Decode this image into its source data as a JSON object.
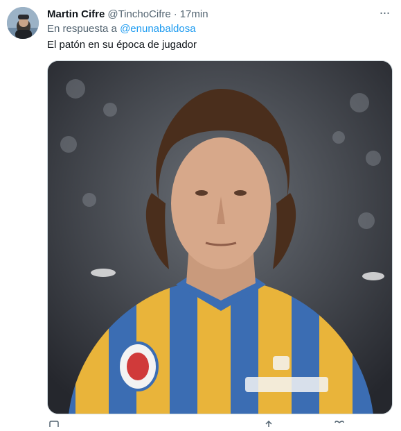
{
  "tweet": {
    "author_name": "Martin Cifre",
    "author_handle": "@TinchoCifre",
    "separator": "·",
    "time": "17min",
    "reply_prefix": "En respuesta a",
    "reply_to": "@enunabaldosa",
    "text": "El patón en su época de jugador",
    "more_glyph": "···"
  },
  "colors": {
    "accent": "#1d9bf0",
    "secondary_text": "#536471",
    "jersey_blue": "#3a6fb5",
    "jersey_yellow": "#e8b63a"
  },
  "icons": [
    "more-icon",
    "reply-icon",
    "retweet-icon",
    "like-icon",
    "share-icon"
  ]
}
